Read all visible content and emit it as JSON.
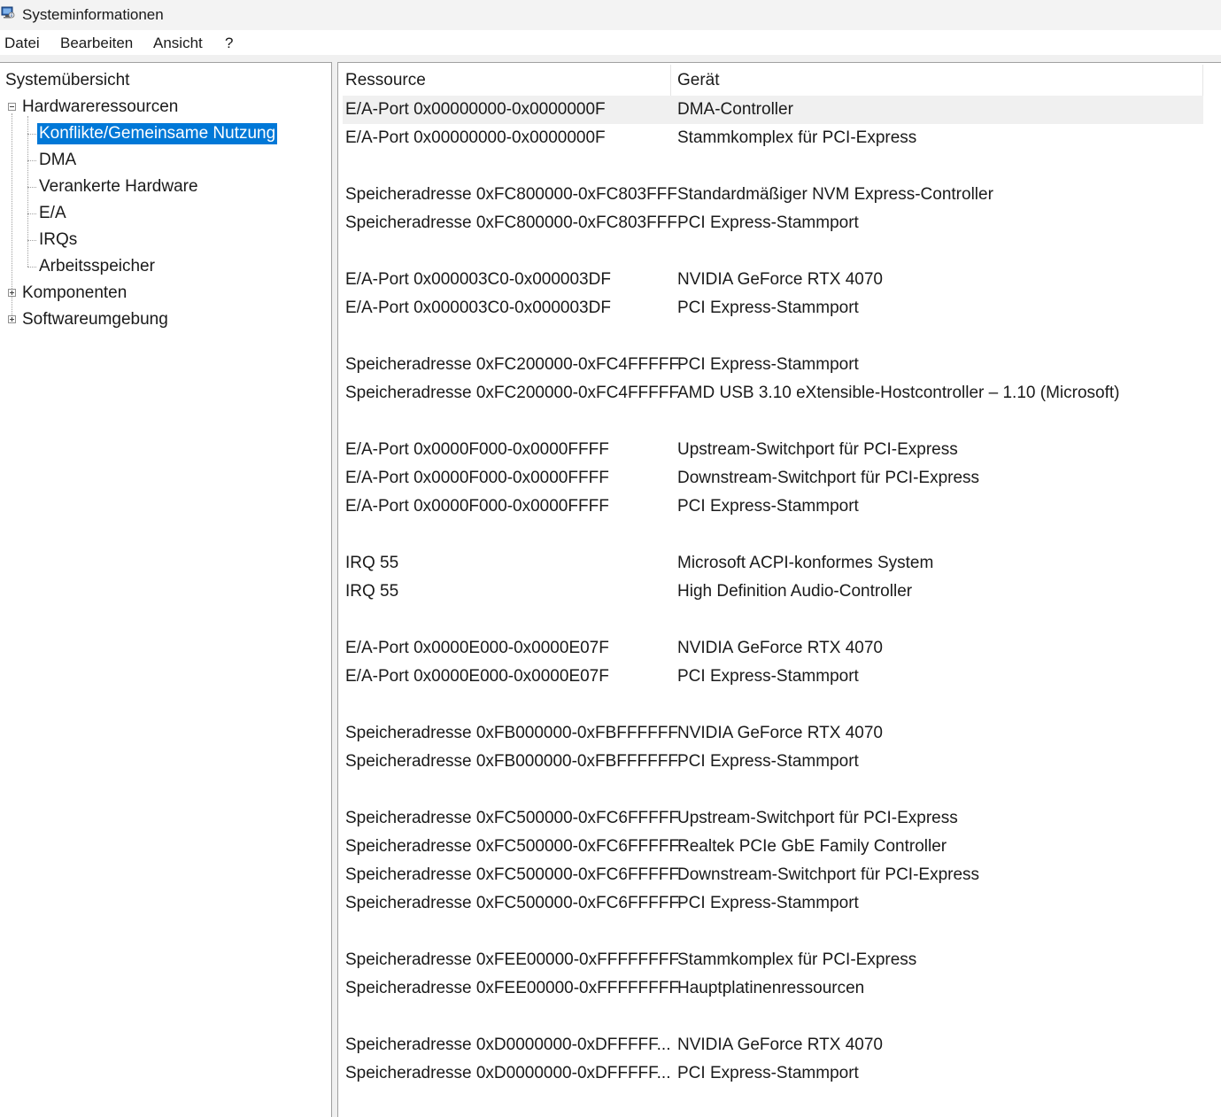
{
  "window": {
    "title": "Systeminformationen",
    "icon": "system-information-icon"
  },
  "menu": [
    "Datei",
    "Bearbeiten",
    "Ansicht",
    "?"
  ],
  "tree": {
    "root": "Systemübersicht",
    "hardware": "Hardwareressourcen",
    "hardware_children": [
      "Konflikte/Gemeinsame Nutzung",
      "DMA",
      "Verankerte Hardware",
      "E/A",
      "IRQs",
      "Arbeitsspeicher"
    ],
    "components": "Komponenten",
    "software": "Softwareumgebung",
    "selected": "Konflikte/Gemeinsame Nutzung"
  },
  "table": {
    "columns": [
      "Ressource",
      "Gerät"
    ],
    "rows": [
      {
        "resource": "E/A-Port 0x00000000-0x0000000F",
        "device": "DMA-Controller"
      },
      {
        "resource": "E/A-Port 0x00000000-0x0000000F",
        "device": "Stammkomplex für PCI-Express"
      },
      {
        "resource": "",
        "device": ""
      },
      {
        "resource": "Speicheradresse 0xFC800000-0xFC803FFF",
        "device": "Standardmäßiger NVM Express-Controller"
      },
      {
        "resource": "Speicheradresse 0xFC800000-0xFC803FFF",
        "device": "PCI Express-Stammport"
      },
      {
        "resource": "",
        "device": ""
      },
      {
        "resource": "E/A-Port 0x000003C0-0x000003DF",
        "device": "NVIDIA GeForce RTX 4070"
      },
      {
        "resource": "E/A-Port 0x000003C0-0x000003DF",
        "device": "PCI Express-Stammport"
      },
      {
        "resource": "",
        "device": ""
      },
      {
        "resource": "Speicheradresse 0xFC200000-0xFC4FFFFF",
        "device": "PCI Express-Stammport"
      },
      {
        "resource": "Speicheradresse 0xFC200000-0xFC4FFFFF",
        "device": "AMD USB 3.10 eXtensible-Hostcontroller – 1.10 (Microsoft)"
      },
      {
        "resource": "",
        "device": ""
      },
      {
        "resource": "E/A-Port 0x0000F000-0x0000FFFF",
        "device": "Upstream-Switchport für PCI-Express"
      },
      {
        "resource": "E/A-Port 0x0000F000-0x0000FFFF",
        "device": "Downstream-Switchport für PCI-Express"
      },
      {
        "resource": "E/A-Port 0x0000F000-0x0000FFFF",
        "device": "PCI Express-Stammport"
      },
      {
        "resource": "",
        "device": ""
      },
      {
        "resource": "IRQ 55",
        "device": "Microsoft ACPI-konformes System"
      },
      {
        "resource": "IRQ 55",
        "device": "High Definition Audio-Controller"
      },
      {
        "resource": "",
        "device": ""
      },
      {
        "resource": "E/A-Port 0x0000E000-0x0000E07F",
        "device": "NVIDIA GeForce RTX 4070"
      },
      {
        "resource": "E/A-Port 0x0000E000-0x0000E07F",
        "device": "PCI Express-Stammport"
      },
      {
        "resource": "",
        "device": ""
      },
      {
        "resource": "Speicheradresse 0xFB000000-0xFBFFFFFF",
        "device": "NVIDIA GeForce RTX 4070"
      },
      {
        "resource": "Speicheradresse 0xFB000000-0xFBFFFFFF",
        "device": "PCI Express-Stammport"
      },
      {
        "resource": "",
        "device": ""
      },
      {
        "resource": "Speicheradresse 0xFC500000-0xFC6FFFFF",
        "device": "Upstream-Switchport für PCI-Express"
      },
      {
        "resource": "Speicheradresse 0xFC500000-0xFC6FFFFF",
        "device": "Realtek PCIe GbE Family Controller"
      },
      {
        "resource": "Speicheradresse 0xFC500000-0xFC6FFFFF",
        "device": "Downstream-Switchport für PCI-Express"
      },
      {
        "resource": "Speicheradresse 0xFC500000-0xFC6FFFFF",
        "device": "PCI Express-Stammport"
      },
      {
        "resource": "",
        "device": ""
      },
      {
        "resource": "Speicheradresse 0xFEE00000-0xFFFFFFFF",
        "device": "Stammkomplex für PCI-Express"
      },
      {
        "resource": "Speicheradresse 0xFEE00000-0xFFFFFFFF",
        "device": "Hauptplatinenressourcen"
      },
      {
        "resource": "",
        "device": ""
      },
      {
        "resource": "Speicheradresse 0xD0000000-0xDFFFFF...",
        "device": "NVIDIA GeForce RTX 4070"
      },
      {
        "resource": "Speicheradresse 0xD0000000-0xDFFFFF...",
        "device": "PCI Express-Stammport"
      }
    ]
  }
}
